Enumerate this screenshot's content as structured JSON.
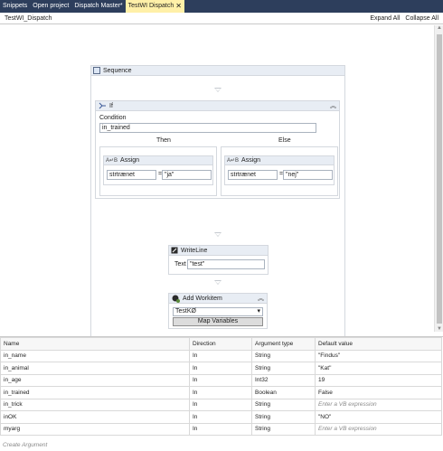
{
  "tabs": [
    {
      "label": "Snippets",
      "active": false
    },
    {
      "label": "Open project",
      "active": false
    },
    {
      "label": "Dispatch Master*",
      "active": false
    },
    {
      "label": "TestWI Dispatch",
      "active": true
    }
  ],
  "header": {
    "breadcrumb": "TestWI_Dispatch",
    "expand_all": "Expand All",
    "collapse_all": "Collapse All"
  },
  "sequence": {
    "title": "Sequence",
    "if_activity": {
      "title": "If",
      "condition_label": "Condition",
      "condition_value": "in_trained",
      "then_label": "Then",
      "else_label": "Else",
      "then_assign": {
        "title": "Assign",
        "to": "strtrænet",
        "value": "\"ja\""
      },
      "else_assign": {
        "title": "Assign",
        "to": "strtrænet",
        "value": "\"nej\""
      }
    },
    "writeline": {
      "title": "WriteLine",
      "text_label": "Text",
      "text_value": "\"test\""
    },
    "workitem": {
      "title": "Add Workitem",
      "queue": "TestKØ",
      "map_button": "Map Variables"
    }
  },
  "grid": {
    "headers": [
      "Name",
      "Direction",
      "Argument type",
      "Default value"
    ],
    "rows": [
      {
        "name": "in_name",
        "direction": "In",
        "type": "String",
        "default": "\"Findus\"",
        "hint": false
      },
      {
        "name": "in_animal",
        "direction": "In",
        "type": "String",
        "default": "\"Kat\"",
        "hint": false
      },
      {
        "name": "in_age",
        "direction": "In",
        "type": "Int32",
        "default": "19",
        "hint": false
      },
      {
        "name": "in_trained",
        "direction": "In",
        "type": "Boolean",
        "default": "False",
        "hint": false
      },
      {
        "name": "in_trick",
        "direction": "In",
        "type": "String",
        "default": "Enter a VB expression",
        "hint": true
      },
      {
        "name": "inOK",
        "direction": "In",
        "type": "String",
        "default": "\"NO\"",
        "hint": false
      },
      {
        "name": "myarg",
        "direction": "In",
        "type": "String",
        "default": "Enter a VB expression",
        "hint": true
      }
    ],
    "create_label": "Create Argument"
  },
  "colors": {
    "tab_bar": "#2d3e5c",
    "active_tab": "#fff0a8",
    "activity_header": "#e8edf4"
  }
}
